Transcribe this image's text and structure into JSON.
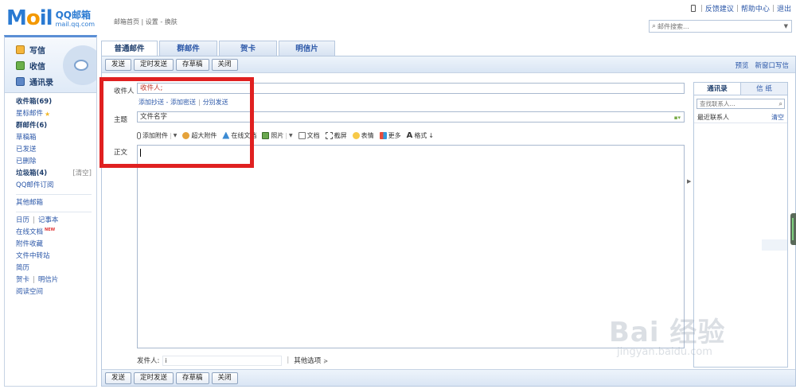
{
  "logo": {
    "brand": "Mail",
    "cn": "QQ邮箱",
    "url": "mail.qq.com"
  },
  "top_nav": "邮箱首页 | 设置 - 换肤",
  "top_links": {
    "feedback": "反馈建议",
    "help": "帮助中心",
    "logout": "退出"
  },
  "search": {
    "placeholder": "邮件搜索..."
  },
  "sidebar": {
    "write": "写信",
    "inbox": "收信",
    "contacts": "通讯录",
    "folders": [
      {
        "label": "收件箱(69)",
        "bold": true
      },
      {
        "label": "星标邮件",
        "star": true
      },
      {
        "label": "群邮件(6)",
        "bold": true
      },
      {
        "label": "草稿箱"
      },
      {
        "label": "已发送"
      },
      {
        "label": "已删除"
      },
      {
        "label": "垃圾箱(4)",
        "bold": true,
        "extra": "[清空]"
      },
      {
        "label": "QQ邮件订阅"
      }
    ],
    "other": "其他邮箱",
    "tools": {
      "calendar": "日历",
      "notes": "记事本",
      "docs": "在线文档",
      "docs_badge": "NEW",
      "attachments": "附件收藏",
      "transfer": "文件中转站",
      "resume": "简历",
      "card": "贺卡",
      "postcard": "明信片",
      "reading": "阅读空间"
    }
  },
  "tabs": [
    "普通邮件",
    "群邮件",
    "贺卡",
    "明信片"
  ],
  "toolbar": {
    "send": "发送",
    "timed": "定时发送",
    "draft": "存草稿",
    "close": "关闭",
    "preview": "预览",
    "new_window": "新窗口写信"
  },
  "compose": {
    "to_label": "收件人",
    "to_value": "收件人;",
    "add_cc": "添加抄送",
    "add_bcc": "添加密送",
    "separate": "分别发送",
    "subject_label": "主题",
    "subject_value": "文件名字",
    "body_label": "正文",
    "editor_tools": {
      "attach": "添加附件",
      "big_attach": "超大附件",
      "online_doc": "在线文档",
      "photo": "照片",
      "doc": "文档",
      "screenshot": "截屏",
      "emoji": "表情",
      "more": "更多",
      "format": "格式"
    },
    "sender_label": "发件人:",
    "sender_value": "i",
    "other_options": "其他选项"
  },
  "contacts_panel": {
    "tab_contacts": "通讯录",
    "tab_stationery": "信 纸",
    "search_placeholder": "查找联系人...",
    "recent": "最近联系人",
    "clear": "清空"
  },
  "watermark": {
    "main": "Bai 经验",
    "sub": "jingyan.baidu.com"
  },
  "colors": {
    "accent": "#2b57a8",
    "highlight_box": "#e02020",
    "logo_blue": "#2a7ad2",
    "logo_orange": "#f39800"
  }
}
